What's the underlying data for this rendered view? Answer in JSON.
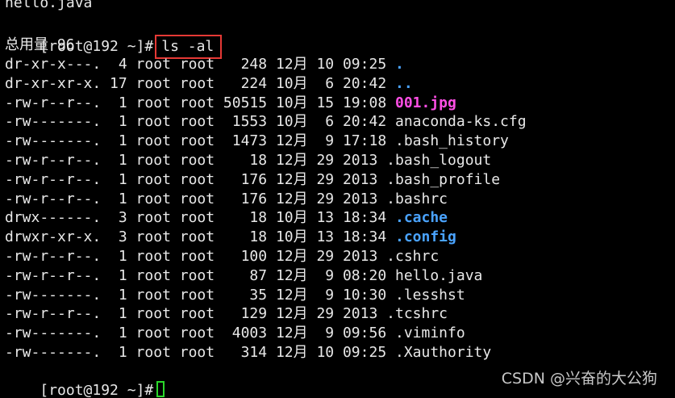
{
  "terminal": {
    "top_partial_line": "hello.java",
    "prompt": "[root@192 ~]#",
    "command": "ls -al",
    "total_line": "总用量 96",
    "listing": [
      {
        "meta": "dr-xr-x---.  4 root root   248 12月 10 09:25 ",
        "name": ".",
        "color": "blue"
      },
      {
        "meta": "dr-xr-xr-x. 17 root root   224 10月  6 20:42 ",
        "name": "..",
        "color": "blue"
      },
      {
        "meta": "-rw-r--r--.  1 root root 50515 10月 15 19:08 ",
        "name": "001.jpg",
        "color": "magenta"
      },
      {
        "meta": "-rw-------.  1 root root  1553 10月  6 20:42 ",
        "name": "anaconda-ks.cfg",
        "color": "default"
      },
      {
        "meta": "-rw-------.  1 root root  1473 12月  9 17:18 ",
        "name": ".bash_history",
        "color": "default"
      },
      {
        "meta": "-rw-r--r--.  1 root root    18 12月 29 2013 ",
        "name": ".bash_logout",
        "color": "default"
      },
      {
        "meta": "-rw-r--r--.  1 root root   176 12月 29 2013 ",
        "name": ".bash_profile",
        "color": "default"
      },
      {
        "meta": "-rw-r--r--.  1 root root   176 12月 29 2013 ",
        "name": ".bashrc",
        "color": "default"
      },
      {
        "meta": "drwx------.  3 root root    18 10月 13 18:34 ",
        "name": ".cache",
        "color": "blue"
      },
      {
        "meta": "drwxr-xr-x.  3 root root    18 10月 13 18:34 ",
        "name": ".config",
        "color": "blue"
      },
      {
        "meta": "-rw-r--r--.  1 root root   100 12月 29 2013 ",
        "name": ".cshrc",
        "color": "default"
      },
      {
        "meta": "-rw-r--r--.  1 root root    87 12月  9 08:20 ",
        "name": "hello.java",
        "color": "default"
      },
      {
        "meta": "-rw-------.  1 root root    35 12月  9 10:30 ",
        "name": ".lesshst",
        "color": "default"
      },
      {
        "meta": "-rw-r--r--.  1 root root   129 12月 29 2013 ",
        "name": ".tcshrc",
        "color": "default"
      },
      {
        "meta": "-rw-------.  1 root root  4003 12月  9 09:56 ",
        "name": ".viminfo",
        "color": "default"
      },
      {
        "meta": "-rw-------.  1 root root   314 12月 10 09:25 ",
        "name": ".Xauthority",
        "color": "default"
      }
    ],
    "final_prompt": "[root@192 ~]#"
  },
  "watermark": "CSDN @兴奋的大公狗",
  "colors": {
    "background": "#000000",
    "text": "#e8e8e8",
    "directory": "#4aa3ff",
    "image": "#ff4fe6",
    "highlight_box": "#e53935",
    "cursor": "#2bd82b"
  }
}
